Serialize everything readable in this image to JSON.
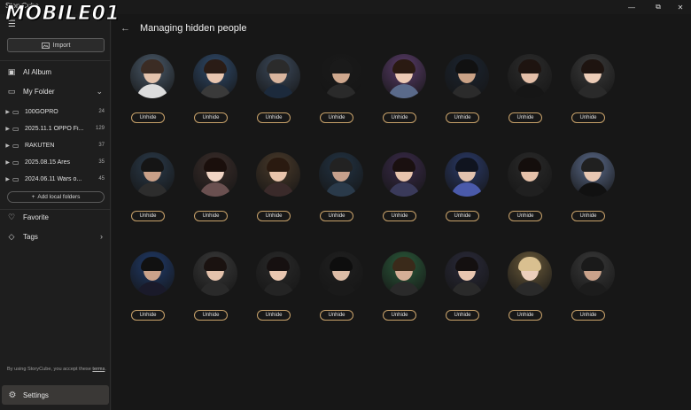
{
  "window": {
    "title": "StoryCube",
    "minimize_icon": "—",
    "maximize_icon": "⧉",
    "close_icon": "✕"
  },
  "watermark": "MOBILE01",
  "sidebar": {
    "import_label": "Import",
    "ai_album_label": "AI Album",
    "my_folder_label": "My Folder",
    "folders": [
      {
        "name": "100GOPRO",
        "count": "24"
      },
      {
        "name": "2025.11.1 OPPO Fi...",
        "count": "129"
      },
      {
        "name": "RAKUTEN",
        "count": "37"
      },
      {
        "name": "2025.08.15 Ares",
        "count": "35"
      },
      {
        "name": "2024.06.11 Wars o...",
        "count": "45"
      }
    ],
    "add_folders_label": "Add local folders",
    "favorite_label": "Favorite",
    "tags_label": "Tags",
    "terms_text": "By using StoryCube, you accept these ",
    "terms_link": "terms",
    "settings_label": "Settings"
  },
  "main": {
    "title": "Managing hidden people",
    "unhide_label": "Unhide",
    "people_count": 24
  },
  "colors": {
    "accent_border": "#c8a26a",
    "background": "#171717",
    "sidebar": "#1e1e1e"
  }
}
